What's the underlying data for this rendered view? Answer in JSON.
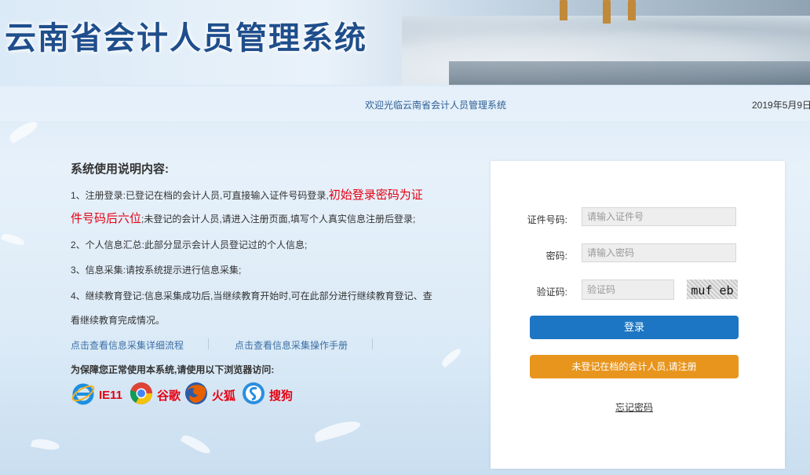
{
  "header": {
    "title": "云南省会计人员管理系统",
    "welcome": "欢迎光临云南省会计人员管理系统",
    "date": "2019年5月9日"
  },
  "instructions": {
    "title": "系统使用说明内容:",
    "item1_a": "1、注册登录:已登记在档的会计人员,可直接输入证件号码登录,",
    "item1_red1": "初始登录密码为证",
    "item1_red2": "件号码后六位",
    "item1_b": ";未登记的会计人员,请进入注册页面,填写个人真实信息注册后登录;",
    "item2": "2、个人信息汇总:此部分显示会计人员登记过的个人信息;",
    "item3": "3、信息采集:请按系统提示进行信息采集;",
    "item4_a": "4、继续教育登记:信息采集成功后,当继续教育开始时,可在此部分进行继续教育登记、查",
    "item4_b": "看继续教育完成情况。",
    "link1": "点击查看信息采集详细流程",
    "link2": "点击查看信息采集操作手册",
    "browser_tip": "为保障您正常使用本系统,请使用以下浏览器访问:"
  },
  "browsers": [
    {
      "name": "IE11",
      "icon": "ie-icon"
    },
    {
      "name": "谷歌",
      "icon": "chrome-icon"
    },
    {
      "name": "火狐",
      "icon": "firefox-icon"
    },
    {
      "name": "搜狗",
      "icon": "sogou-icon"
    }
  ],
  "login": {
    "id_label": "证件号码:",
    "id_placeholder": "请输入证件号",
    "pwd_label": "密码:",
    "pwd_placeholder": "请输入密码",
    "code_label": "验证码:",
    "code_placeholder": "验证码",
    "captcha_text": "muf eb",
    "login_button": "登录",
    "register_button": "未登记在档的会计人员,请注册",
    "forgot": "忘记密码"
  },
  "colors": {
    "title": "#1f4e8c",
    "login_button": "#1d76c3",
    "register_button": "#e8951d",
    "highlight_red": "#e60012",
    "link": "#3b6fa6"
  }
}
